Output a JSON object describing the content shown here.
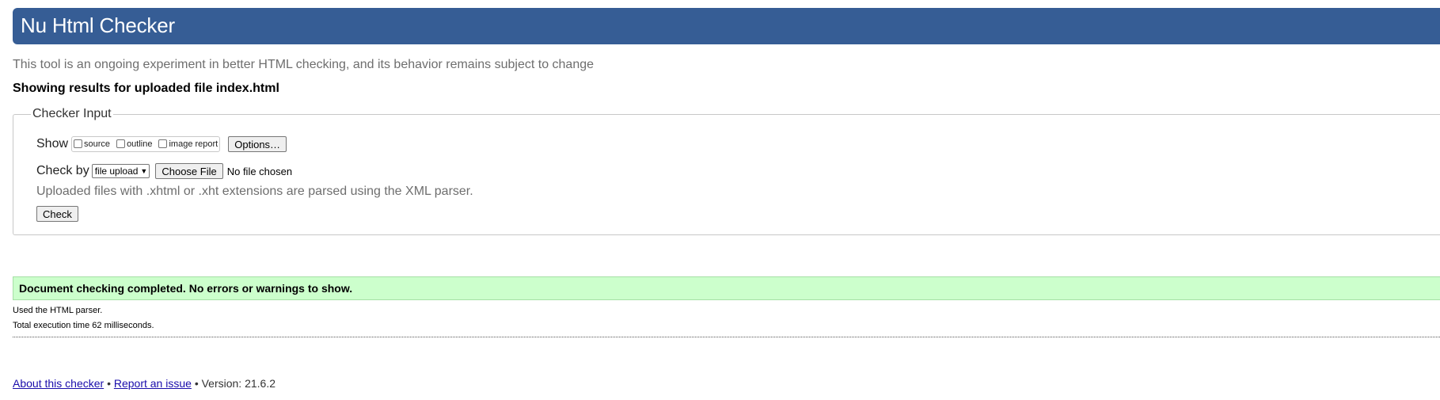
{
  "header": {
    "title": "Nu Html Checker"
  },
  "tagline": "This tool is an ongoing experiment in better HTML checking, and its behavior remains subject to change",
  "results_heading": "Showing results for uploaded file index.html",
  "checker_input": {
    "legend": "Checker Input",
    "show_label": "Show",
    "show_options": [
      {
        "label": "source",
        "checked": false
      },
      {
        "label": "outline",
        "checked": false
      },
      {
        "label": "image report",
        "checked": false
      }
    ],
    "options_button": "Options…",
    "check_by_label": "Check by",
    "check_by_selected": "file upload",
    "choose_file_button": "Choose File",
    "no_file_text": "No file chosen",
    "xml_note": "Uploaded files with .xhtml or .xht extensions are parsed using the XML parser.",
    "check_button": "Check"
  },
  "result": {
    "message": "Document checking completed. No errors or warnings to show.",
    "parser_note": "Used the HTML parser.",
    "execution_time": "Total execution time 62 milliseconds."
  },
  "footer": {
    "about_link": "About this checker",
    "separator": "•",
    "report_link": "Report an issue",
    "version": "Version: 21.6.2"
  },
  "colors": {
    "header_bg": "#365d95",
    "success_bg": "#ccffcc",
    "link": "#1a0dab"
  }
}
